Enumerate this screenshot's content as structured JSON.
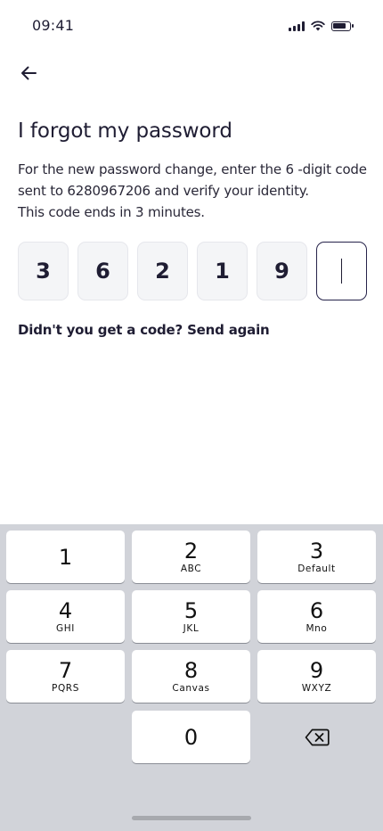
{
  "status_bar": {
    "time": "09:41"
  },
  "header": {
    "back_icon": "arrow-left-icon"
  },
  "title": "I forgot my password",
  "instructions": {
    "line1": "For the new password change, enter the 6 -digit code",
    "line2": "sent to 6280967206 and verify your identity.",
    "line3": "This code ends in 3 minutes."
  },
  "otp": {
    "digits": [
      "3",
      "6",
      "2",
      "1",
      "9",
      ""
    ],
    "active_index": 5
  },
  "resend": {
    "prompt": "Didn't you get a code?",
    "link": "Send again"
  },
  "keypad": {
    "keys": [
      {
        "digit": "1",
        "letters": ""
      },
      {
        "digit": "2",
        "letters": "ABC"
      },
      {
        "digit": "3",
        "letters": "Default"
      },
      {
        "digit": "4",
        "letters": "GHI"
      },
      {
        "digit": "5",
        "letters": "JKL"
      },
      {
        "digit": "6",
        "letters": "Mno"
      },
      {
        "digit": "7",
        "letters": "PQRS"
      },
      {
        "digit": "8",
        "letters": "Canvas"
      },
      {
        "digit": "9",
        "letters": "WXYZ"
      }
    ],
    "zero": "0",
    "delete_icon": "backspace-icon"
  },
  "colors": {
    "text": "#1f1d33",
    "active_border": "#26234a",
    "box_bg": "#f4f5f7",
    "keypad_bg": "#d1d3d9"
  }
}
